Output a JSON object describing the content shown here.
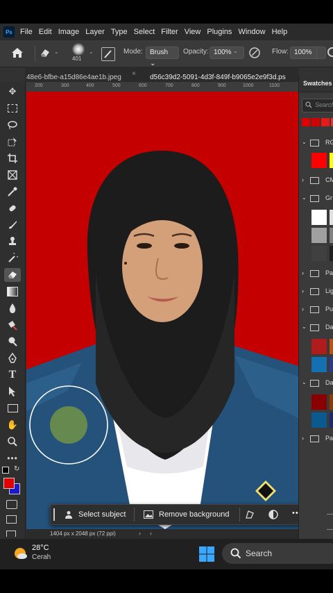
{
  "app": {
    "logo": "Ps"
  },
  "menu": [
    "File",
    "Edit",
    "Image",
    "Layer",
    "Type",
    "Select",
    "Filter",
    "View",
    "Plugins",
    "Window",
    "Help"
  ],
  "options": {
    "brush_size": "401",
    "mode_label": "Mode:",
    "mode_value": "Brush",
    "opacity_label": "Opacity:",
    "opacity_value": "100%",
    "flow_label": "Flow:",
    "flow_value": "100%"
  },
  "tabs": [
    {
      "label": "48e6-bfbe-a15d86e4ae1b.jpeg",
      "close": "×"
    },
    {
      "label": "d56c39d2-5091-4d3f-849f-b9065e2e9f3d.ps",
      "close": ""
    }
  ],
  "ruler_ticks": [
    "200",
    "300",
    "400",
    "500",
    "600",
    "700",
    "800",
    "900",
    "1000",
    "1100"
  ],
  "context_bar": {
    "select_subject": "Select subject",
    "remove_background": "Remove background",
    "more": "•••"
  },
  "status_text": "1404 px x 2048 px (72 ppi)",
  "panel": {
    "title": "Swatches",
    "search_placeholder": "Search",
    "groups": [
      "RG",
      "CM",
      "Gr",
      "Pa",
      "Lig",
      "Pu",
      "Da",
      "Da",
      "Pa"
    ]
  },
  "colors": {
    "foreground": "#e00000",
    "background": "#1a1acc",
    "canvas_bg": "#c00000"
  },
  "taskbar": {
    "temperature": "28°C",
    "weather": "Cerah",
    "search": "Search"
  }
}
